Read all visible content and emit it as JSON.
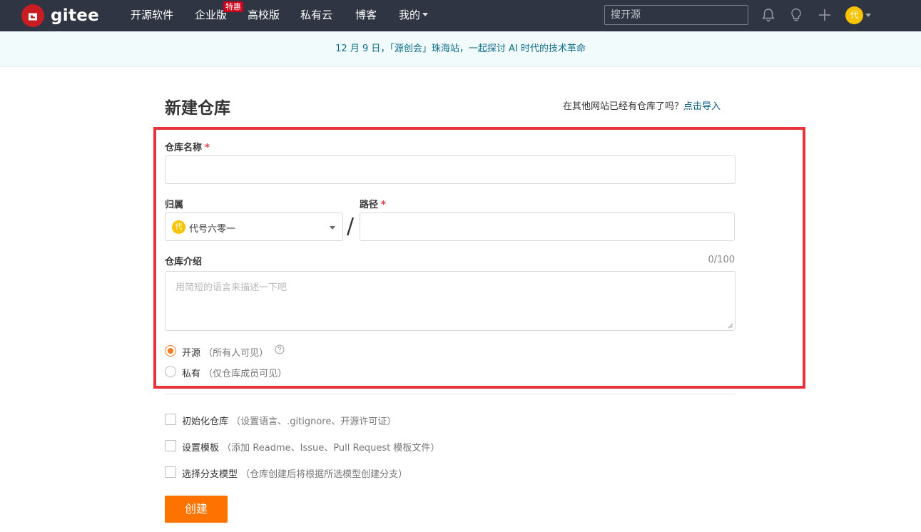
{
  "nav": {
    "brand": "gitee",
    "items": [
      {
        "label": "开源软件"
      },
      {
        "label": "企业版"
      },
      {
        "label": "高校版"
      },
      {
        "label": "私有云"
      },
      {
        "label": "博客"
      },
      {
        "label": "我的"
      }
    ],
    "badge": "特惠",
    "search_placeholder": "搜开源",
    "avatar_char": "代"
  },
  "banner": {
    "text": "12 月 9 日，「源创会」珠海站，一起探讨 AI 时代的技术革命"
  },
  "page": {
    "title": "新建仓库",
    "import_prompt": "在其他网站已经有仓库了吗？",
    "import_link": "点击导入"
  },
  "form": {
    "repo_name_label": "仓库名称",
    "required_mark": "*",
    "repo_name_value": "",
    "owner_label": "归属",
    "owner_avatar_char": "代",
    "owner_value": "代号六零一",
    "slash": "/",
    "path_label": "路径",
    "path_value": "",
    "description_label": "仓库介绍",
    "description_counter": "0/100",
    "description_placeholder": "用简短的语言来描述一下吧",
    "visibility": [
      {
        "label": "开源",
        "hint": "（所有人可见）",
        "selected": true
      },
      {
        "label": "私有",
        "hint": "（仅仓库成员可见）",
        "selected": false
      }
    ],
    "options": [
      {
        "label": "初始化仓库",
        "hint": "（设置语言、.gitignore、开源许可证）",
        "checked": false
      },
      {
        "label": "设置模板",
        "hint": "（添加 Readme、Issue、Pull Request 模板文件）",
        "checked": false
      },
      {
        "label": "选择分支模型",
        "hint": "（仓库创建后将根据所选模型创建分支）",
        "checked": false
      }
    ],
    "submit_label": "创建"
  },
  "colors": {
    "nav_bg": "#2f3542",
    "brand_red": "#c71d23",
    "accent_orange": "#fe7300",
    "highlight_red": "#e8333b",
    "link_blue": "#005980"
  }
}
